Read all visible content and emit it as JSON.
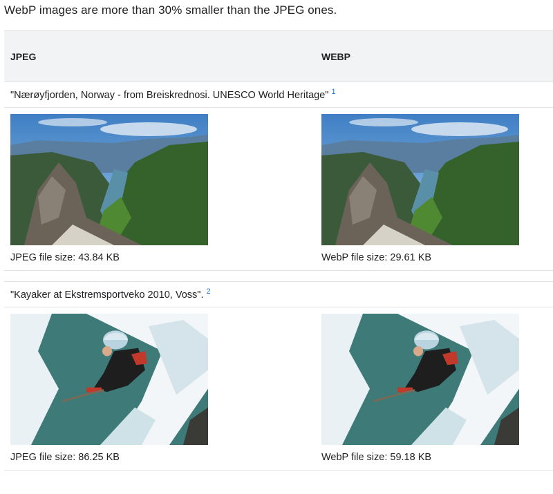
{
  "intro": "WebP images are more than 30% smaller than the JPEG ones.",
  "table": {
    "headers": [
      "JPEG",
      "WEBP"
    ],
    "rows": [
      {
        "caption": "\"Nærøyfjorden, Norway - from Breiskrednosi. UNESCO World Heritage\"",
        "footnote": "1",
        "image_subject": "fjord-landscape",
        "jpeg_size": "JPEG file size: 43.84 KB",
        "webp_size": "WebP file size: 29.61 KB"
      },
      {
        "caption": "\"Kayaker at Ekstremsportveko 2010, Voss\".",
        "footnote": "2",
        "image_subject": "kayaker-whitewater",
        "jpeg_size": "JPEG file size: 86.25 KB",
        "webp_size": "WebP file size: 59.18 KB"
      }
    ]
  }
}
